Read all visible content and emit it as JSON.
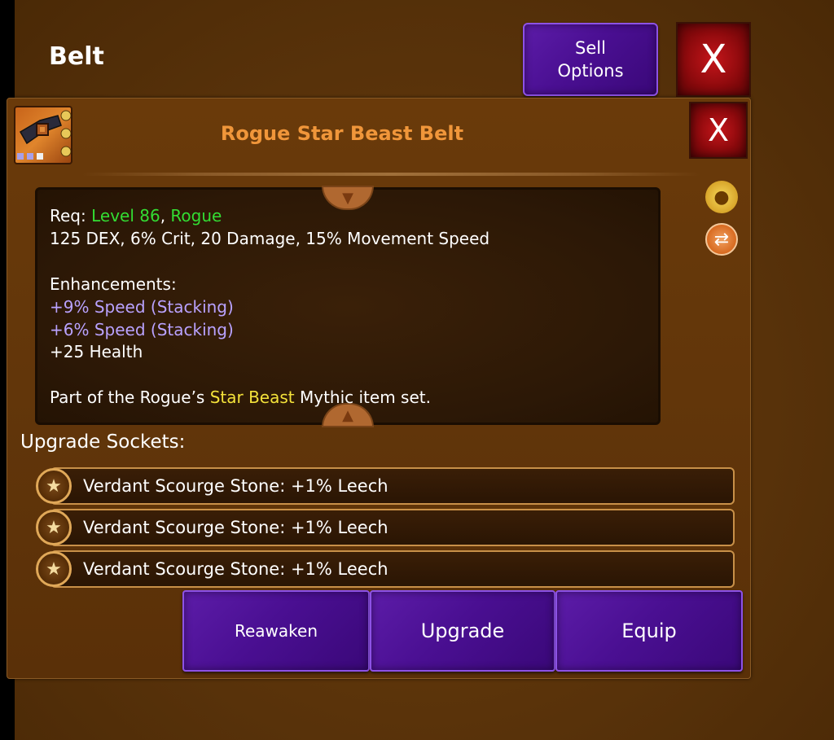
{
  "window": {
    "title": "Belt",
    "sell_options_label_line1": "Sell",
    "sell_options_label_line2": "Options",
    "close_label": "X"
  },
  "item": {
    "name": "Rogue Star Beast Belt",
    "close_label": "X",
    "name_color": "#f0963a",
    "description": {
      "req_prefix": "Req: ",
      "req_level": "Level 86",
      "req_separator": ", ",
      "req_class": "Rogue",
      "stats": "125 DEX, 6% Crit, 20 Damage, 15% Movement Speed",
      "enhancements_label": "Enhancements:",
      "enhancements": [
        "+9% Speed (Stacking)",
        "+6% Speed (Stacking)",
        "+25 Health"
      ],
      "set_prefix": "Part of the Rogue’s ",
      "set_name": "Star Beast",
      "set_suffix": " Mythic item set."
    }
  },
  "sockets": {
    "label": "Upgrade Sockets:",
    "items": [
      "Verdant Scourge Stone: +1% Leech",
      "Verdant Scourge Stone: +1% Leech",
      "Verdant Scourge Stone: +1% Leech"
    ]
  },
  "actions": {
    "reawaken": "Reawaken",
    "upgrade": "Upgrade",
    "equip": "Equip"
  },
  "colors": {
    "background": "#5a3206",
    "button_purple": "#4a0f92",
    "close_red": "#a0101a",
    "requirement_green": "#33dd33",
    "enhancement_lavender": "#b9a2ff",
    "set_yellow": "#f4e23a"
  },
  "icons": {
    "item": "belt-item-icon",
    "gold": "gold-bag-icon",
    "swap": "swap-icon",
    "socket": "star-gem-icon",
    "scroll_up": "scroll-up-icon",
    "scroll_down": "scroll-down-icon"
  }
}
